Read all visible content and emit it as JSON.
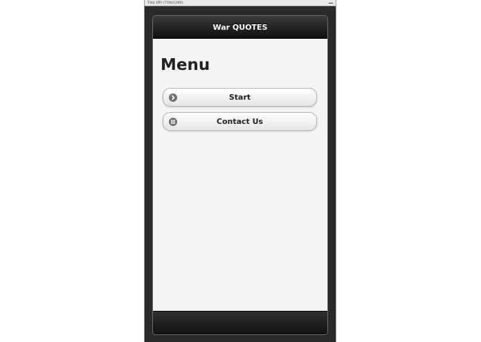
{
  "window": {
    "title": "Tiny HD (720x1280)"
  },
  "header": {
    "title": "War QUOTES"
  },
  "menu": {
    "heading": "Menu",
    "items": [
      {
        "label": "Start",
        "icon": "arrow-right-icon"
      },
      {
        "label": "Contact Us",
        "icon": "grid-icon"
      }
    ]
  },
  "colors": {
    "header_bg": "#1c1c1c",
    "content_bg": "#f4f4f4",
    "icon_bg": "#6f6f6f"
  }
}
